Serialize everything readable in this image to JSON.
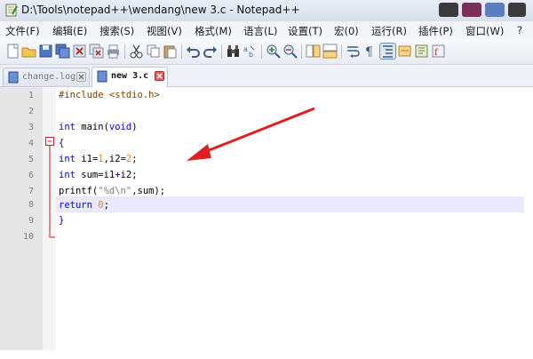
{
  "window": {
    "title": "D:\\Tools\\notepad++\\wendang\\new  3.c - Notepad++"
  },
  "menu": {
    "items": [
      "文件(F)",
      "编辑(E)",
      "搜索(S)",
      "视图(V)",
      "格式(M)",
      "语言(L)",
      "设置(T)",
      "宏(0)",
      "运行(R)",
      "插件(P)",
      "窗口(W)",
      "?"
    ]
  },
  "toolbar": {
    "icons": [
      "new-file-icon",
      "open-file-icon",
      "save-icon",
      "save-all-icon",
      "close-icon",
      "close-all-icon",
      "print-icon",
      "cut-icon",
      "copy-icon",
      "paste-icon",
      "undo-icon",
      "redo-icon",
      "find-icon",
      "replace-icon",
      "zoom-in-icon",
      "zoom-out-icon",
      "sync-vertical-icon",
      "sync-horizontal-icon",
      "word-wrap-icon",
      "show-all-chars-icon",
      "indent-guide-icon",
      "user-lang-icon",
      "doc-map-icon",
      "function-list-icon"
    ]
  },
  "tabs": [
    {
      "label": "change.log",
      "active": false
    },
    {
      "label": "new  3.c",
      "active": true
    }
  ],
  "editor": {
    "line_numbers": [
      "1",
      "2",
      "3",
      "4",
      "5",
      "6",
      "7",
      "8",
      "9",
      "10"
    ],
    "lines": {
      "l1": "#include <stdio.h>",
      "l3_kw": "int",
      "l3_rest": " main(",
      "l3_void": "void",
      "l3_end": ")",
      "l4": "{",
      "l5_kw": "int",
      "l5_a": " i1",
      "l5_eq1": "=",
      "l5_n1": "1",
      "l5_b": ",i2",
      "l5_eq2": "=",
      "l5_n2": "2",
      "l5_end": ";",
      "l6_kw": "int",
      "l6_a": " sum",
      "l6_eq": "=",
      "l6_b": "i1",
      "l6_plus": "+",
      "l6_c": "i2;",
      "l7_a": "printf(",
      "l7_str": "\"%d\\n\"",
      "l7_b": ",sum);",
      "l8_kw": "return",
      "l8_n": " 0",
      "l8_end": ";",
      "l9": "}"
    },
    "fold_marker": "⊟",
    "current_line": 8
  },
  "annotation": {
    "arrow_color": "#e02020"
  },
  "colors": {
    "keyword": "#0000ff",
    "number": "#ff8000",
    "string": "#808080",
    "current_line": "#e8e8ff"
  }
}
